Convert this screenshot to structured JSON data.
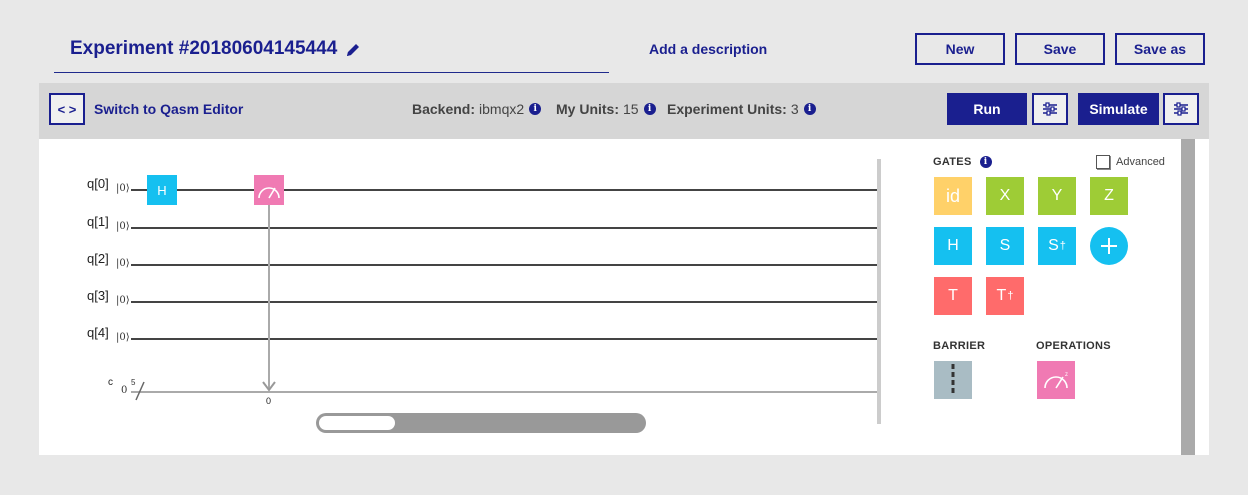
{
  "header": {
    "title": "Experiment #20180604145444",
    "add_description": "Add a description",
    "buttons": {
      "new": "New",
      "save": "Save",
      "save_as": "Save as"
    }
  },
  "toolbar": {
    "code_icon": "< >",
    "switch_label": "Switch to Qasm Editor",
    "backend_label": "Backend:",
    "backend_value": "ibmqx2",
    "units_label": "My Units:",
    "units_value": "15",
    "exp_units_label": "Experiment Units:",
    "exp_units_value": "3",
    "run": "Run",
    "simulate": "Simulate"
  },
  "circuit": {
    "qubits": [
      {
        "label": "q[0]",
        "ket": "|0⟩"
      },
      {
        "label": "q[1]",
        "ket": "|0⟩"
      },
      {
        "label": "q[2]",
        "ket": "|0⟩"
      },
      {
        "label": "q[3]",
        "ket": "|0⟩"
      },
      {
        "label": "q[4]",
        "ket": "|0⟩"
      }
    ],
    "classical": {
      "label": "c",
      "init": "0",
      "width": "5"
    },
    "placed_gate_h": "H",
    "measure_target": "0"
  },
  "palette": {
    "gates_title": "GATES",
    "advanced_label": "Advanced",
    "gates": {
      "id": "id",
      "x": "X",
      "y": "Y",
      "z": "Z",
      "h": "H",
      "s": "S",
      "sdg": "S",
      "t": "T",
      "tdg": "T",
      "dagger": "†"
    },
    "barrier_title": "BARRIER",
    "operations_title": "OPERATIONS"
  },
  "colors": {
    "brand": "#1a1f8f",
    "gate_yellow": "#ffd169",
    "gate_green": "#9ecc36",
    "gate_blue": "#15c0f0",
    "gate_red": "#ff6b6b",
    "gate_pink": "#f07ab3",
    "gate_gray": "#a9bcc4"
  },
  "icons": [
    "pencil-icon",
    "code-icon",
    "info-icon",
    "settings-sliders-icon",
    "measure-icon",
    "barrier-icon",
    "plus-icon"
  ]
}
